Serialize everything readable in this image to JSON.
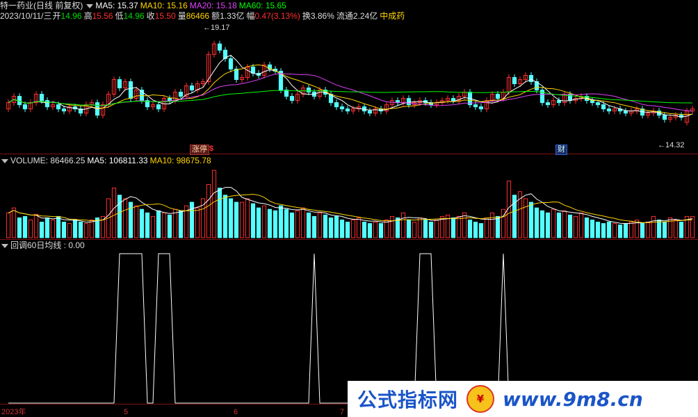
{
  "header": {
    "name": "特一药业(日线 前复权)",
    "ma": [
      {
        "label": "MA5: 15.37",
        "color": "#ffffff"
      },
      {
        "label": "MA10: 15.16",
        "color": "#ffd700"
      },
      {
        "label": "MA20: 15.18",
        "color": "#e040fb"
      },
      {
        "label": "MA60: 15.65",
        "color": "#00ff00"
      }
    ]
  },
  "quote": {
    "date": "2023/10/11/三",
    "open_l": "开",
    "open_v": "14.96",
    "high_l": "高",
    "high_v": "15.56",
    "low_l": "低",
    "low_v": "14.96",
    "close_l": "收",
    "close_v": "15.50",
    "vol_l": "量",
    "vol_v": "86466",
    "amt_l": "额",
    "amt_v": "1.33亿",
    "chg_l": "幅",
    "chg_v": "0.47(3.13%)",
    "turn_l": "换",
    "turn_v": "3.86%",
    "float_l": "流通",
    "float_v": "2.24亿",
    "sector": "中成药"
  },
  "price_marks": {
    "high": "19.17",
    "low": "14.32"
  },
  "event_tags": {
    "t1": "涨停",
    "t2": "$",
    "t3": "财"
  },
  "volume_header": {
    "label": "VOLUME: 86466.25",
    "ma5": "MA5: 106811.33",
    "ma10": "MA10: 98675.78"
  },
  "indicator_header": {
    "label": "回调60日均线 : 0.00"
  },
  "x_axis": [
    "2023年",
    "5",
    "6",
    "7"
  ],
  "watermark": {
    "text1": "公式指标网",
    "text2": "www.9m8.cn"
  },
  "chart_data": {
    "type": "candlestick",
    "ylim": [
      14.0,
      19.6
    ],
    "colors": {
      "up": "#ff3030",
      "down": "#54ffff",
      "ma5": "#ffffff",
      "ma10": "#ffd700",
      "ma20": "#e040fb",
      "ma60": "#00ff00"
    },
    "close": [
      15.9,
      16.2,
      15.8,
      15.6,
      15.9,
      16.3,
      16.0,
      15.7,
      15.8,
      15.6,
      15.5,
      15.7,
      15.6,
      15.4,
      15.8,
      15.9,
      15.3,
      15.8,
      16.3,
      17.0,
      16.6,
      16.9,
      16.1,
      16.5,
      16.0,
      15.7,
      15.8,
      15.6,
      16.1,
      16.0,
      16.4,
      16.2,
      16.7,
      16.5,
      16.8,
      16.9,
      18.2,
      18.7,
      18.4,
      18.0,
      17.5,
      17.0,
      17.1,
      17.6,
      17.3,
      17.2,
      17.7,
      17.5,
      17.4,
      16.5,
      16.2,
      16.0,
      16.3,
      16.6,
      16.4,
      16.2,
      16.5,
      16.3,
      15.9,
      15.7,
      15.6,
      15.5,
      15.6,
      15.7,
      15.5,
      15.4,
      15.6,
      15.5,
      15.8,
      16.0,
      15.9,
      16.1,
      15.8,
      15.9,
      16.0,
      15.9,
      15.8,
      15.9,
      16.0,
      16.1,
      16.0,
      16.2,
      16.4,
      15.8,
      15.7,
      15.6,
      16.0,
      16.3,
      16.1,
      16.4,
      17.1,
      16.8,
      17.0,
      17.2,
      16.9,
      16.5,
      15.9,
      15.8,
      16.0,
      15.9,
      16.3,
      16.0,
      16.1,
      16.2,
      16.0,
      15.9,
      15.8,
      15.6,
      15.5,
      15.6,
      15.5,
      15.4,
      15.5,
      15.6,
      15.3,
      15.4,
      15.5,
      15.3,
      15.1,
      15.2,
      15.3,
      15.2,
      15.5,
      15.6
    ],
    "open": [
      15.6,
      15.9,
      16.2,
      15.8,
      15.6,
      15.9,
      16.3,
      16.0,
      15.7,
      15.8,
      15.6,
      15.5,
      15.7,
      15.6,
      15.4,
      15.8,
      15.9,
      15.3,
      15.8,
      16.3,
      17.0,
      16.6,
      16.9,
      16.1,
      16.5,
      16.0,
      15.7,
      15.8,
      15.6,
      16.1,
      16.0,
      16.4,
      16.2,
      16.7,
      16.5,
      16.8,
      16.9,
      18.2,
      18.7,
      18.4,
      18.0,
      17.5,
      17.0,
      17.1,
      17.6,
      17.3,
      17.2,
      17.7,
      17.5,
      17.4,
      16.5,
      16.2,
      16.0,
      16.3,
      16.6,
      16.4,
      16.2,
      16.5,
      16.3,
      15.9,
      15.7,
      15.6,
      15.5,
      15.6,
      15.7,
      15.5,
      15.4,
      15.6,
      15.5,
      15.8,
      16.0,
      15.9,
      16.1,
      15.8,
      15.9,
      16.0,
      15.9,
      15.8,
      15.9,
      16.0,
      16.1,
      16.0,
      16.2,
      16.4,
      15.8,
      15.7,
      15.6,
      16.0,
      16.3,
      16.1,
      16.4,
      17.1,
      16.8,
      17.0,
      17.2,
      16.9,
      16.5,
      15.9,
      15.8,
      16.0,
      15.9,
      16.3,
      16.0,
      16.1,
      16.2,
      16.0,
      15.9,
      15.8,
      15.6,
      15.5,
      15.6,
      15.5,
      15.4,
      15.5,
      15.6,
      15.3,
      15.4,
      15.5,
      15.3,
      15.1,
      15.2,
      15.3,
      14.96,
      15.5
    ],
    "volume_rel": [
      0.35,
      0.42,
      0.28,
      0.3,
      0.25,
      0.33,
      0.22,
      0.28,
      0.25,
      0.3,
      0.22,
      0.2,
      0.25,
      0.22,
      0.2,
      0.25,
      0.28,
      0.3,
      0.55,
      0.7,
      0.6,
      0.55,
      0.5,
      0.45,
      0.4,
      0.35,
      0.3,
      0.38,
      0.35,
      0.32,
      0.4,
      0.38,
      0.45,
      0.5,
      0.42,
      0.55,
      0.75,
      0.95,
      0.7,
      0.6,
      0.55,
      0.5,
      0.5,
      0.55,
      0.48,
      0.42,
      0.45,
      0.4,
      0.38,
      0.45,
      0.4,
      0.35,
      0.38,
      0.42,
      0.35,
      0.3,
      0.35,
      0.32,
      0.28,
      0.3,
      0.25,
      0.22,
      0.25,
      0.28,
      0.22,
      0.2,
      0.22,
      0.2,
      0.25,
      0.3,
      0.28,
      0.35,
      0.25,
      0.22,
      0.28,
      0.25,
      0.22,
      0.25,
      0.3,
      0.32,
      0.28,
      0.3,
      0.35,
      0.25,
      0.22,
      0.2,
      0.28,
      0.35,
      0.3,
      0.4,
      0.8,
      0.6,
      0.65,
      0.55,
      0.5,
      0.42,
      0.38,
      0.35,
      0.4,
      0.35,
      0.38,
      0.32,
      0.3,
      0.35,
      0.28,
      0.25,
      0.22,
      0.2,
      0.22,
      0.2,
      0.18,
      0.2,
      0.22,
      0.25,
      0.2,
      0.22,
      0.3,
      0.25,
      0.22,
      0.28,
      0.25,
      0.22,
      0.3,
      0.3
    ],
    "indicator": [
      0,
      0,
      0,
      0,
      0,
      0,
      0,
      0,
      0,
      0,
      0,
      0,
      0,
      0,
      0,
      0,
      0,
      0,
      0,
      0,
      1,
      1,
      1,
      1,
      1,
      0,
      0,
      1,
      1,
      1,
      0,
      0,
      0,
      0,
      0,
      0,
      0,
      0,
      0,
      0,
      0,
      0,
      0,
      0,
      0,
      0,
      0,
      0,
      0,
      0,
      0,
      0,
      0,
      0,
      0,
      1,
      0,
      0,
      0,
      0,
      0,
      0,
      0,
      0,
      0,
      0,
      0,
      0,
      0,
      0,
      0,
      0,
      0,
      0,
      1,
      1,
      1,
      0,
      0,
      0,
      0,
      0,
      0,
      0,
      0,
      0,
      0,
      0,
      0,
      1,
      0,
      0,
      0,
      0,
      0,
      0,
      0,
      0,
      0,
      0,
      0,
      0,
      0,
      0,
      0,
      0,
      0,
      0,
      0,
      0,
      0,
      0,
      0,
      0,
      0,
      0,
      0,
      0,
      0,
      0,
      0,
      0,
      0,
      0
    ]
  }
}
